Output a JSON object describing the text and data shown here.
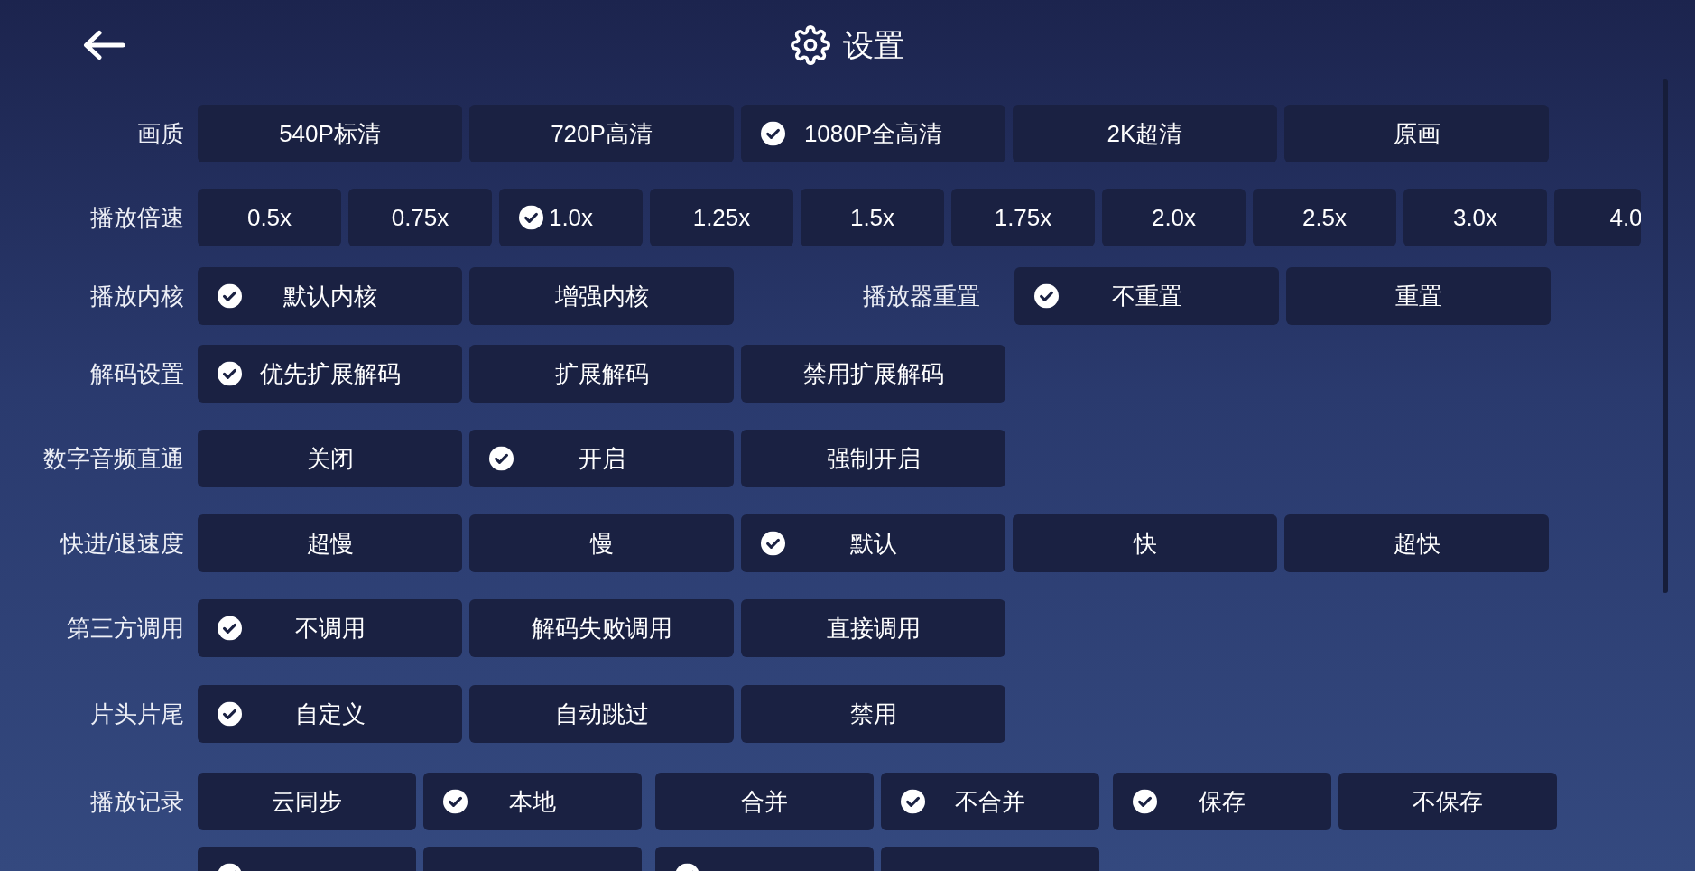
{
  "header": {
    "title": "设置"
  },
  "settings": [
    {
      "label": "画质",
      "groups": [
        {
          "options": [
            {
              "label": "540P标清",
              "selected": false
            },
            {
              "label": "720P高清",
              "selected": false
            },
            {
              "label": "1080P全高清",
              "selected": true
            },
            {
              "label": "2K超清",
              "selected": false
            },
            {
              "label": "原画",
              "selected": false
            }
          ]
        }
      ]
    },
    {
      "label": "播放倍速",
      "groups": [
        {
          "options": [
            {
              "label": "0.5x",
              "selected": false
            },
            {
              "label": "0.75x",
              "selected": false
            },
            {
              "label": "1.0x",
              "selected": true
            },
            {
              "label": "1.25x",
              "selected": false
            },
            {
              "label": "1.5x",
              "selected": false
            },
            {
              "label": "1.75x",
              "selected": false
            },
            {
              "label": "2.0x",
              "selected": false
            },
            {
              "label": "2.5x",
              "selected": false
            },
            {
              "label": "3.0x",
              "selected": false
            },
            {
              "label": "4.0",
              "selected": false
            }
          ]
        }
      ]
    },
    {
      "label": "播放内核",
      "groups": [
        {
          "options": [
            {
              "label": "默认内核",
              "selected": true
            },
            {
              "label": "增强内核",
              "selected": false
            }
          ]
        },
        {
          "label": "播放器重置",
          "options": [
            {
              "label": "不重置",
              "selected": true
            },
            {
              "label": "重置",
              "selected": false
            }
          ]
        }
      ]
    },
    {
      "label": "解码设置",
      "groups": [
        {
          "options": [
            {
              "label": "优先扩展解码",
              "selected": true
            },
            {
              "label": "扩展解码",
              "selected": false
            },
            {
              "label": "禁用扩展解码",
              "selected": false
            }
          ]
        }
      ]
    },
    {
      "label": "数字音频直通",
      "groups": [
        {
          "options": [
            {
              "label": "关闭",
              "selected": false
            },
            {
              "label": "开启",
              "selected": true
            },
            {
              "label": "强制开启",
              "selected": false
            }
          ]
        }
      ]
    },
    {
      "label": "快进/退速度",
      "groups": [
        {
          "options": [
            {
              "label": "超慢",
              "selected": false
            },
            {
              "label": "慢",
              "selected": false
            },
            {
              "label": "默认",
              "selected": true
            },
            {
              "label": "快",
              "selected": false
            },
            {
              "label": "超快",
              "selected": false
            }
          ]
        }
      ]
    },
    {
      "label": "第三方调用",
      "groups": [
        {
          "options": [
            {
              "label": "不调用",
              "selected": true
            },
            {
              "label": "解码失败调用",
              "selected": false
            },
            {
              "label": "直接调用",
              "selected": false
            }
          ]
        }
      ]
    },
    {
      "label": "片头片尾",
      "groups": [
        {
          "options": [
            {
              "label": "自定义",
              "selected": true
            },
            {
              "label": "自动跳过",
              "selected": false
            },
            {
              "label": "禁用",
              "selected": false
            }
          ]
        }
      ]
    },
    {
      "label": "播放记录",
      "groups": [
        {
          "options": [
            {
              "label": "云同步",
              "selected": false
            },
            {
              "label": "本地",
              "selected": true
            }
          ]
        },
        {
          "options": [
            {
              "label": "合并",
              "selected": false
            },
            {
              "label": "不合并",
              "selected": true
            }
          ]
        },
        {
          "options": [
            {
              "label": "保存",
              "selected": true
            },
            {
              "label": "不保存",
              "selected": false
            }
          ]
        }
      ]
    },
    {
      "groups": [
        {
          "options": [
            {
              "selected": true
            },
            {
              "selected": false
            }
          ]
        },
        {
          "options": [
            {
              "selected": true
            },
            {
              "selected": false
            }
          ]
        }
      ]
    }
  ]
}
